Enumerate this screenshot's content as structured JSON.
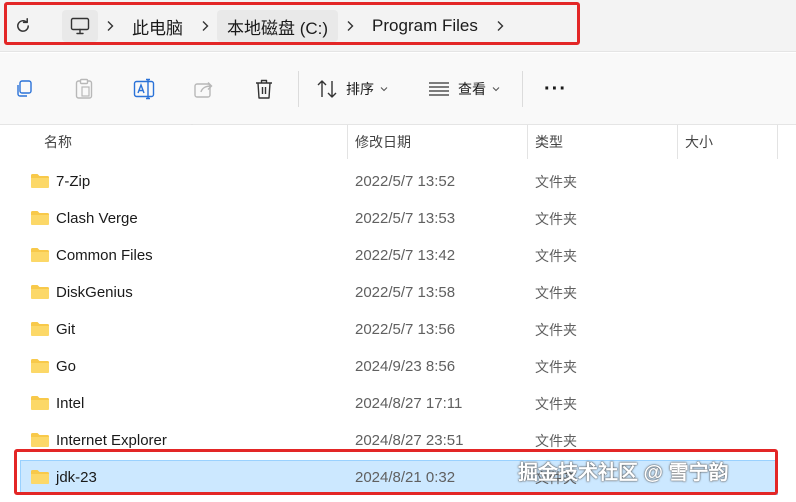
{
  "address_bar": {
    "breadcrumbs": [
      "此电脑",
      "本地磁盘 (C:)",
      "Program Files"
    ]
  },
  "toolbar": {
    "sort_label": "排序",
    "view_label": "查看",
    "more_label": "···"
  },
  "columns": {
    "name": "名称",
    "date": "修改日期",
    "type": "类型",
    "size": "大小"
  },
  "files": [
    {
      "name": "7-Zip",
      "date": "2022/5/7 13:52",
      "type": "文件夹"
    },
    {
      "name": "Clash Verge",
      "date": "2022/5/7 13:53",
      "type": "文件夹"
    },
    {
      "name": "Common Files",
      "date": "2022/5/7 13:42",
      "type": "文件夹"
    },
    {
      "name": "DiskGenius",
      "date": "2022/5/7 13:58",
      "type": "文件夹"
    },
    {
      "name": "Git",
      "date": "2022/5/7 13:56",
      "type": "文件夹"
    },
    {
      "name": "Go",
      "date": "2024/9/23 8:56",
      "type": "文件夹"
    },
    {
      "name": "Intel",
      "date": "2024/8/27 17:11",
      "type": "文件夹"
    },
    {
      "name": "Internet Explorer",
      "date": "2024/8/27 23:51",
      "type": "文件夹"
    },
    {
      "name": "jdk-23",
      "date": "2024/8/21 0:32",
      "type": "文件夹"
    }
  ],
  "selected_index": 8,
  "watermark": "掘金技术社区 @ 雪宁韵",
  "colors": {
    "highlight_box": "#e32626",
    "selection_bg": "#cce8ff",
    "folder_yellow": "#f8c94a"
  }
}
